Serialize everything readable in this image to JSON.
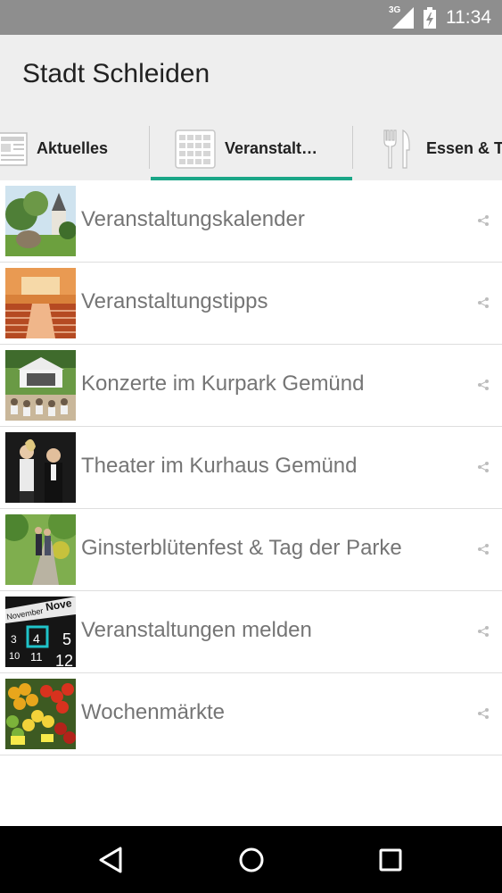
{
  "status_bar": {
    "network": "3G",
    "time": "11:34"
  },
  "app": {
    "title": "Stadt Schleiden"
  },
  "tabs": [
    {
      "label": "Aktuelles",
      "icon": "newspaper-icon",
      "selected": false
    },
    {
      "label": "Veranstalt…",
      "icon": "calendar-grid-icon",
      "selected": true
    },
    {
      "label": "Essen & Tr",
      "icon": "fork-knife-icon",
      "selected": false
    }
  ],
  "list": {
    "items": [
      {
        "label": "Veranstaltungskalender",
        "thumb": "church-landscape"
      },
      {
        "label": "Veranstaltungstipps",
        "thumb": "concert-hall"
      },
      {
        "label": "Konzerte im Kurpark Gemünd",
        "thumb": "outdoor-band"
      },
      {
        "label": "Theater im Kurhaus Gemünd",
        "thumb": "theater-actors"
      },
      {
        "label": "Ginsterblütenfest & Tag der Parke",
        "thumb": "park-walk"
      },
      {
        "label": "Veranstaltungen melden",
        "thumb": "calendar-board"
      },
      {
        "label": "Wochenmärkte",
        "thumb": "fruit-market"
      }
    ]
  },
  "calendar_thumb": {
    "month": "November",
    "month_short": "Nove",
    "numbers": [
      "3",
      "4",
      "5",
      "10",
      "11",
      "12"
    ]
  },
  "colors": {
    "accent": "#1aa687",
    "app_bar": "#eeeeee",
    "status_bar": "#8e8e8e",
    "text_secondary": "#757575"
  }
}
